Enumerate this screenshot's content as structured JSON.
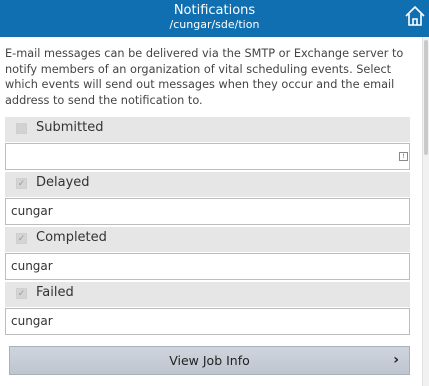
{
  "header": {
    "title": "Notifications",
    "subtitle": "/cungar/sde/tion"
  },
  "description": "E-mail messages can be delivered via the SMTP or Exchange server to notify members of an organization of vital scheduling events. Select which events will send out messages when they occur and the email address to send the notification to.",
  "events": [
    {
      "label": "Submitted",
      "checked": false,
      "email": ""
    },
    {
      "label": "Delayed",
      "checked": true,
      "email": "cungar"
    },
    {
      "label": "Completed",
      "checked": true,
      "email": "cungar"
    },
    {
      "label": "Failed",
      "checked": true,
      "email": "cungar"
    }
  ],
  "check_glyph": "✓",
  "button": {
    "label": "View Job Info",
    "chevron": "›"
  },
  "colors": {
    "header_bg": "#0f6fb0",
    "row_bg": "#e6e6e6",
    "button_bg": "#c7ccd6"
  }
}
